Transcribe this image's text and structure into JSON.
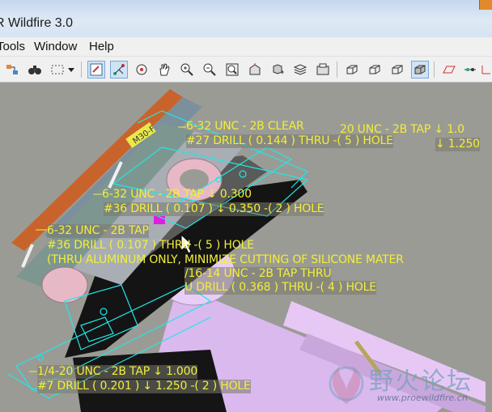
{
  "window": {
    "title": "R Wildfire 3.0"
  },
  "menu": {
    "items": [
      "Tools",
      "Window",
      "Help"
    ]
  },
  "toolbar": {
    "icons": [
      "regenerate-icon",
      "binoculars-icon",
      "select-box-icon",
      "dropdown-arrow-icon",
      "sketch-view-icon",
      "datum-axis-icon",
      "spin-center-icon",
      "pan-hand-icon",
      "zoom-in-icon",
      "zoom-out-icon",
      "refit-icon",
      "orient-icon",
      "saved-views-icon",
      "layers-icon",
      "display-style-icon",
      "wireframe-icon",
      "hidden-line-icon",
      "no-hidden-icon",
      "shaded-icon",
      "datum-plane-icon",
      "datum-point-icon",
      "csys-icon"
    ]
  },
  "model": {
    "part_label": "M30-F",
    "colors": {
      "annotation": "#f2ee3a",
      "wireframe": "#22e6e6",
      "cylinder": "#e6c8f2"
    }
  },
  "annotations": {
    "a1_line1": "6-32 UNC - 2B CLEAR",
    "a1_line2": "#27 DRILL ( 0.144 ) THRU -( 5 ) HOLE",
    "a2_line1": "20 UNC - 2B TAP ↓ 1.0",
    "a2_line2": "↓ 1.250",
    "a3_line1": "6-32 UNC - 2B TAP ↓ 0.300",
    "a3_line2": "#36 DRILL ( 0.107 ) ↓ 0.350 -( 2 ) HOLE",
    "a4_line1": "6-32 UNC - 2B TAP",
    "a4_line2": "#36 DRILL ( 0.107 ) THRU -( 5 ) HOLE",
    "a4_line3": "(THRU ALUMINUM ONLY, MINIMIZE CUTTING OF SILICONE MATER",
    "a5_line1": "/16-14 UNC - 2B TAP THRU",
    "a5_line2": "U DRILL ( 0.368 ) THRU -( 4 ) HOLE",
    "a6_line1": "1/4-20 UNC - 2B TAP ↓ 1.000",
    "a6_line2": "#7 DRILL ( 0.201 ) ↓ 1.250 -( 2 ) HOLE"
  },
  "watermark": {
    "text": "野火论坛",
    "url": "www.proewildfire.cn"
  }
}
